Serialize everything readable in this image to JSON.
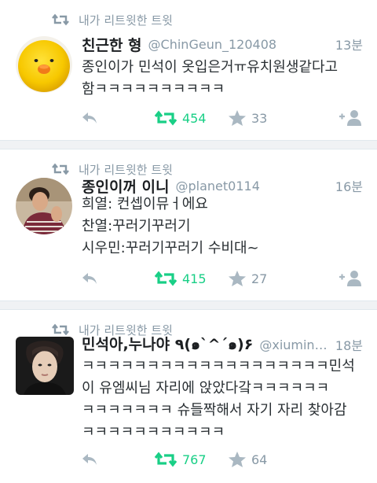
{
  "retweet_label": "내가 리트윗한 트윗",
  "colors": {
    "accent_green": "#19cf86",
    "muted": "#8899a6",
    "separator": "#f0f2f4"
  },
  "tweets": [
    {
      "name": "친근한 형",
      "handle": "@ChinGeun_120408",
      "time": "13분",
      "lines": [
        "종인이가 민석이 옷입은거ㅠ유치원생같다고",
        "함ㅋㅋㅋㅋㅋㅋㅋㅋㅋㅋ"
      ],
      "retweets": "454",
      "likes": "33",
      "avatar_icon": "yellow-character-avatar"
    },
    {
      "name": "종인이꺼 이니",
      "handle": "@planet0114",
      "time": "16분",
      "lines": [
        "희열: 컨셉이뮤ㅓ에요",
        "찬열:꾸러기꾸러기",
        "시우민:꾸러기꾸러기 수비대~"
      ],
      "retweets": "415",
      "likes": "27",
      "avatar_icon": "person-photo-avatar"
    },
    {
      "name": "민석아,누나야 ٩(๑`^´๑)۶",
      "handle": "@xiuminn...",
      "time": "18분",
      "lines": [
        "ㅋㅋㅋㅋㅋㅋㅋㅋㅋㅋㅋㅋㅋㅋㅋㅋㅋㅋㅋ민석",
        "이 유엠씨님 자리에 앉았다갘ㅋㅋㅋㅋㅋㅋ",
        "ㅋㅋㅋㅋㅋㅋㅋ 슈들짝해서 자기 자리 찾아감",
        "ㅋㅋㅋㅋㅋㅋㅋㅋㅋㅋㅋ"
      ],
      "retweets": "767",
      "likes": "64",
      "avatar_icon": "person-photo-avatar"
    }
  ]
}
